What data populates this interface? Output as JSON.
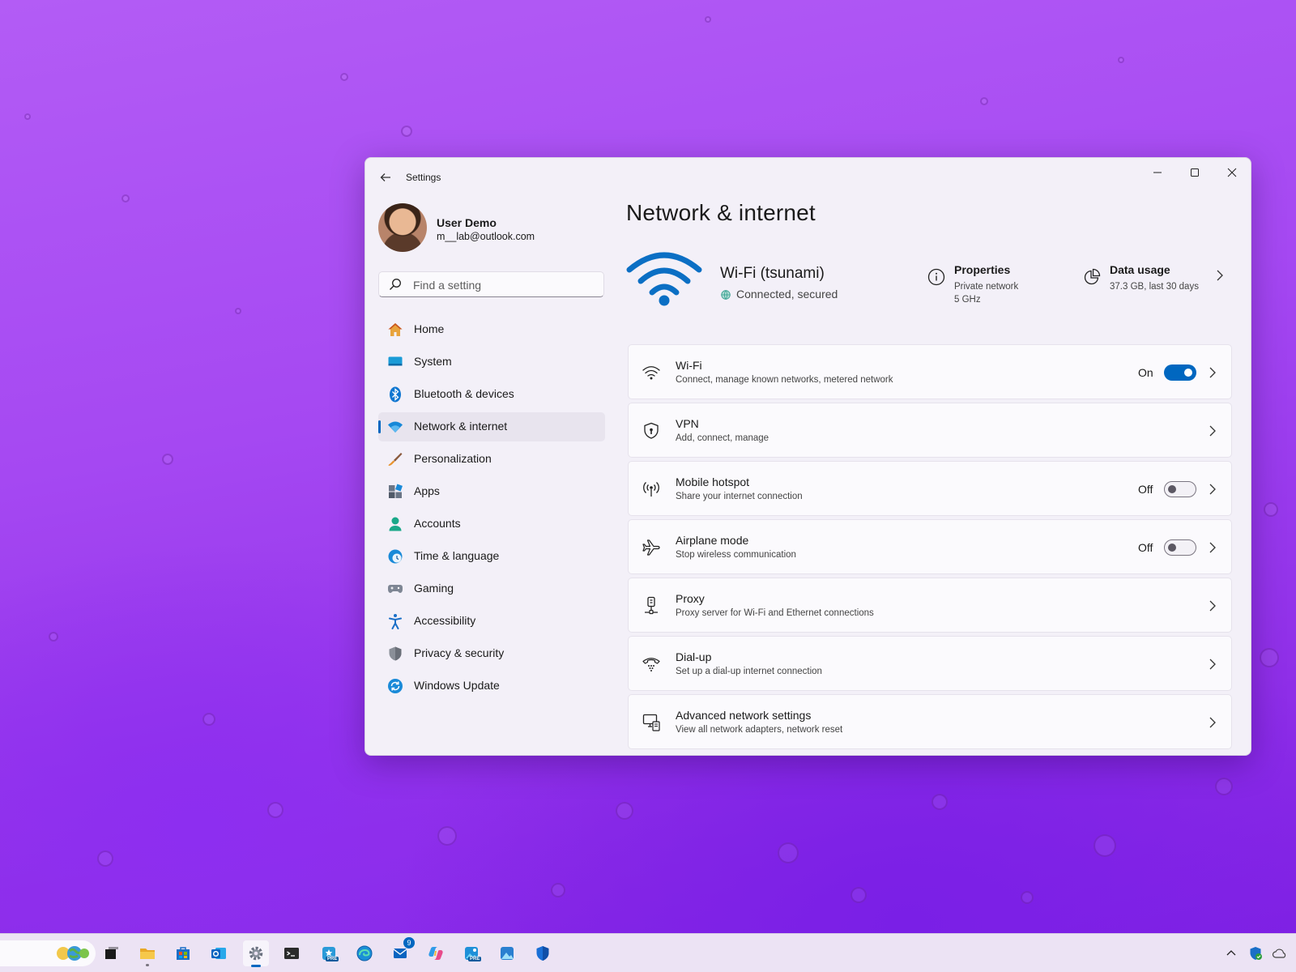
{
  "window": {
    "app_title": "Settings"
  },
  "profile": {
    "name": "User Demo",
    "email": "m__lab@outlook.com"
  },
  "search": {
    "placeholder": "Find a setting"
  },
  "sidebar": {
    "items": [
      {
        "label": "Home",
        "icon": "home-icon"
      },
      {
        "label": "System",
        "icon": "system-icon"
      },
      {
        "label": "Bluetooth & devices",
        "icon": "bluetooth-icon"
      },
      {
        "label": "Network & internet",
        "icon": "network-icon",
        "active": true
      },
      {
        "label": "Personalization",
        "icon": "brush-icon"
      },
      {
        "label": "Apps",
        "icon": "apps-icon"
      },
      {
        "label": "Accounts",
        "icon": "accounts-icon"
      },
      {
        "label": "Time & language",
        "icon": "clock-globe-icon"
      },
      {
        "label": "Gaming",
        "icon": "gamepad-icon"
      },
      {
        "label": "Accessibility",
        "icon": "accessibility-icon"
      },
      {
        "label": "Privacy & security",
        "icon": "shield-icon"
      },
      {
        "label": "Windows Update",
        "icon": "update-icon"
      }
    ]
  },
  "main": {
    "title": "Network & internet",
    "connection": {
      "ssid": "Wi-Fi (tsunami)",
      "status": "Connected, secured"
    },
    "properties": {
      "title": "Properties",
      "line1": "Private network",
      "line2": "5 GHz"
    },
    "data_usage": {
      "title": "Data usage",
      "line1": "37.3 GB, last 30 days"
    },
    "cards": [
      {
        "title": "Wi-Fi",
        "subtitle": "Connect, manage known networks, metered network",
        "icon": "wifi-icon",
        "toggle": "On"
      },
      {
        "title": "VPN",
        "subtitle": "Add, connect, manage",
        "icon": "vpn-shield-icon"
      },
      {
        "title": "Mobile hotspot",
        "subtitle": "Share your internet connection",
        "icon": "hotspot-icon",
        "toggle": "Off"
      },
      {
        "title": "Airplane mode",
        "subtitle": "Stop wireless communication",
        "icon": "airplane-icon",
        "toggle": "Off"
      },
      {
        "title": "Proxy",
        "subtitle": "Proxy server for Wi-Fi and Ethernet connections",
        "icon": "proxy-icon"
      },
      {
        "title": "Dial-up",
        "subtitle": "Set up a dial-up internet connection",
        "icon": "dialup-icon"
      },
      {
        "title": "Advanced network settings",
        "subtitle": "View all network adapters, network reset",
        "icon": "monitor-network-icon"
      }
    ]
  },
  "taskbar": {
    "mail_badge": "9",
    "pre_label": "PRE"
  },
  "colors": {
    "accent": "#0067c0",
    "window_bg": "#f3f0f8",
    "card_bg": "#fbfafd",
    "wallpaper": "#a548f2"
  }
}
